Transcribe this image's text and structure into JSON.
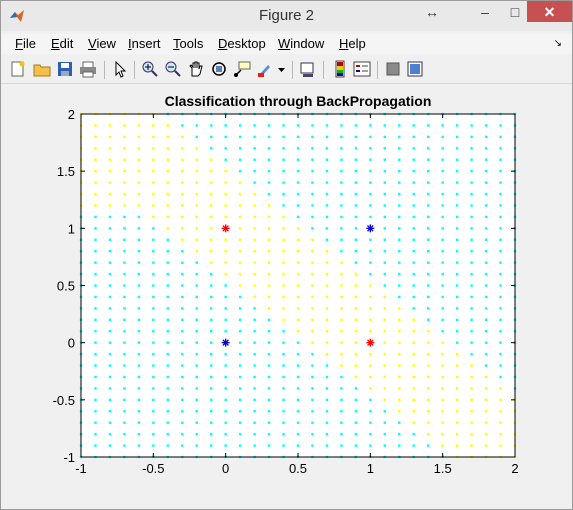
{
  "window": {
    "title": "Figure 2"
  },
  "menu": [
    "File",
    "Edit",
    "View",
    "Insert",
    "Tools",
    "Desktop",
    "Window",
    "Help"
  ],
  "toolbar_icons": [
    "new-figure-icon",
    "open-file-icon",
    "save-icon",
    "print-icon",
    "select-arrow-icon",
    "zoom-in-icon",
    "zoom-out-icon",
    "pan-icon",
    "rotate-3d-icon",
    "data-cursor-icon",
    "brush-icon",
    "brush-dropdown-icon",
    "link-plot-icon",
    "insert-colorbar-icon",
    "insert-legend-icon",
    "hide-plot-tools-icon",
    "show-plot-tools-icon"
  ],
  "colors": {
    "background_class": "#ffff00",
    "grid_class": "#00ffff",
    "class_a_marker": "#ff0000",
    "class_b_marker": "#0000cc",
    "close_button": "#c75050"
  },
  "chart_data": {
    "type": "scatter",
    "title": "Classification through BackPropagation",
    "xlabel": "",
    "ylabel": "",
    "xlim": [
      -1,
      2
    ],
    "ylim": [
      -1,
      2
    ],
    "xticks": [
      "-1",
      "-0.5",
      "0",
      "0.5",
      "1",
      "1.5",
      "2"
    ],
    "yticks": [
      "-1",
      "-0.5",
      "0",
      "0.5",
      "1",
      "1.5",
      "2"
    ],
    "x_tick_values": [
      -1,
      -0.5,
      0,
      0.5,
      1,
      1.5,
      2
    ],
    "y_tick_values": [
      -1,
      -0.5,
      0,
      0.5,
      1,
      1.5,
      2
    ],
    "grid_step": 0.1,
    "background_grid": "cyan dots everywhere except yellow band around class boundary",
    "series": [
      {
        "marker": "*",
        "color": "#ff0000",
        "points": [
          [
            0,
            1
          ],
          [
            1,
            0
          ]
        ]
      },
      {
        "marker": "*",
        "color": "#0000cc",
        "points": [
          [
            0,
            0
          ],
          [
            1,
            1
          ]
        ]
      }
    ]
  }
}
